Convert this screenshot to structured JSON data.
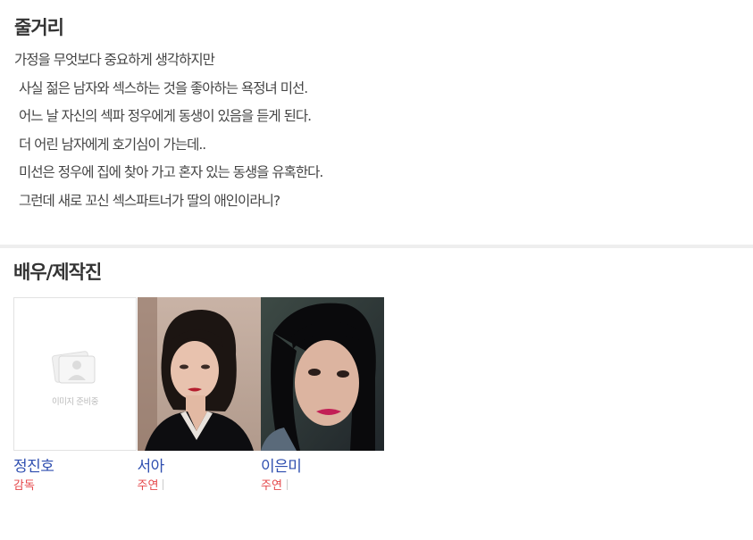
{
  "synopsis": {
    "title": "줄거리",
    "lines": [
      "가정을 무엇보다 중요하게 생각하지만",
      "사실 젊은 남자와 섹스하는 것을 좋아하는 욕정녀 미선.",
      "어느 날 자신의 섹파 정우에게 동생이 있음을 듣게 된다.",
      "더 어린 남자에게 호기심이 가는데..",
      "미선은 정우에 집에 찾아 가고 혼자 있는 동생을 유혹한다.",
      "그런데 새로 꼬신 섹스파트너가 딸의 애인이라니?"
    ]
  },
  "cast": {
    "title": "배우/제작진",
    "placeholder_text": "이미지 준비중",
    "members": [
      {
        "name": "정진호",
        "role": "감독"
      },
      {
        "name": "서아",
        "role": "주연"
      },
      {
        "name": "이은미",
        "role": "주연"
      }
    ]
  },
  "colors": {
    "name_link": "#2f4fb0",
    "role": "#e5474a",
    "divider": "#eeeeee"
  }
}
